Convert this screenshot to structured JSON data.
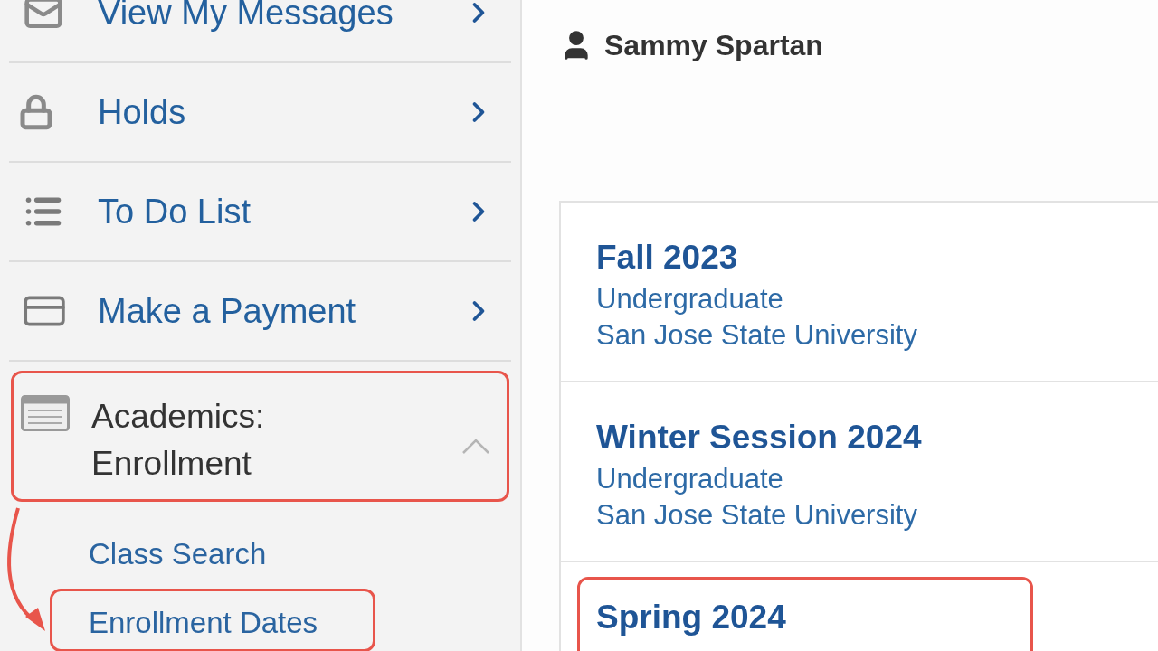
{
  "sidebar": {
    "items": [
      {
        "label": "View My Messages",
        "kind": "link",
        "highlighted": false
      },
      {
        "label": "Holds",
        "kind": "link",
        "highlighted": false
      },
      {
        "label": "To Do List",
        "kind": "link",
        "highlighted": false
      },
      {
        "label": "Make a Payment",
        "kind": "link",
        "highlighted": false
      },
      {
        "label": "Academics: Enrollment",
        "kind": "section",
        "highlighted": true,
        "expanded": true,
        "children": [
          {
            "label": "Class Search",
            "highlighted": false
          },
          {
            "label": "Enrollment Dates",
            "highlighted": true
          }
        ]
      }
    ]
  },
  "user": {
    "name": "Sammy Spartan"
  },
  "terms": [
    {
      "title": "Fall 2023",
      "career": "Undergraduate",
      "institution": "San Jose State University",
      "highlighted": false
    },
    {
      "title": "Winter Session 2024",
      "career": "Undergraduate",
      "institution": "San Jose State University",
      "highlighted": false
    },
    {
      "title": "Spring 2024",
      "highlighted": true
    }
  ]
}
